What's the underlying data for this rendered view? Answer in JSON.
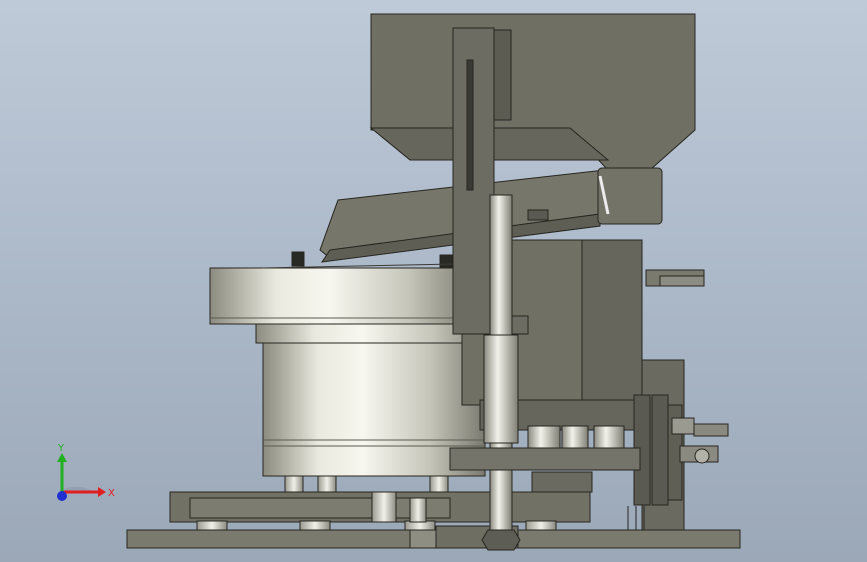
{
  "viewport": {
    "background_top": "#bfcad8",
    "background_bottom": "#9ba8b8"
  },
  "model": {
    "body_color": "#76766a",
    "body_dark": "#5f5f55",
    "edge_color": "#262620",
    "drum_light": "#f2f2ea",
    "drum_mid": "#bdbdb2",
    "drum_dark": "#7d7d73"
  },
  "triad": {
    "x_label": "X",
    "y_label": "Y",
    "x_color": "#e02020",
    "y_color": "#20b020",
    "z_color": "#2030d0"
  }
}
